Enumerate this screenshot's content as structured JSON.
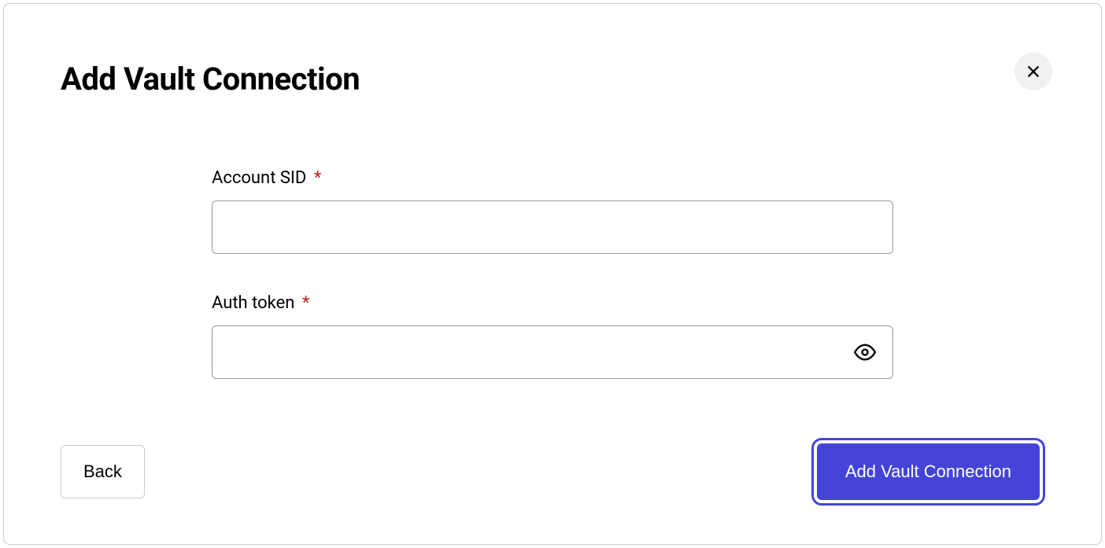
{
  "modal": {
    "title": "Add Vault Connection",
    "fields": {
      "account_sid": {
        "label": "Account SID",
        "required": true,
        "value": ""
      },
      "auth_token": {
        "label": "Auth token",
        "required": true,
        "value": ""
      }
    },
    "actions": {
      "back": "Back",
      "submit": "Add Vault Connection"
    }
  },
  "required_indicator": "*"
}
